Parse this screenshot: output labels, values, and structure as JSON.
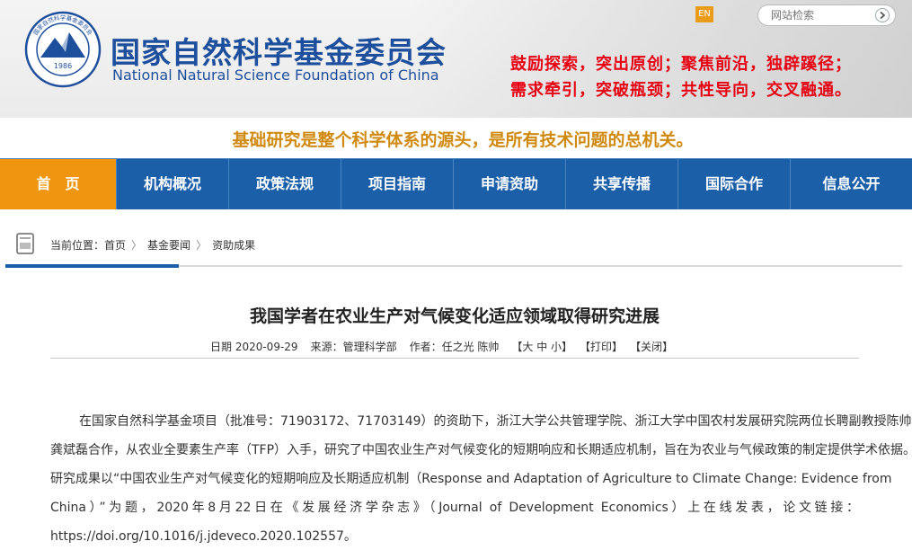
{
  "header": {
    "org_name_cn": "国家自然科学基金委员会",
    "org_name_en": "National Natural Science Foundation of China",
    "seal_year": "1986",
    "seal_ring_text": "国家自然科学基金委员会",
    "lang_button": "EN",
    "search_placeholder": "网站检索",
    "slogan_line1": "鼓励探索，突出原创；聚焦前沿，独辟蹊径；",
    "slogan_line2": "需求牵引，突破瓶颈；共性导向，交叉融通。"
  },
  "tagline": "基础研究是整个科学体系的源头，是所有技术问题的总机关。",
  "nav": {
    "items": [
      "首　页",
      "机构概况",
      "政策法规",
      "项目指南",
      "申请资助",
      "共享传播",
      "国际合作",
      "信息公开"
    ]
  },
  "breadcrumb": {
    "prefix": "当前位置：",
    "items": [
      "首页",
      "基金要闻",
      "资助成果"
    ],
    "separator": "〉"
  },
  "article": {
    "title": "我国学者在农业生产对气候变化适应领域取得研究进展",
    "date": "日期 2020-09-29",
    "source": "来源：管理科学部",
    "author": "作者：任之光 陈帅",
    "font_size_control": "【大 中 小】",
    "print": "【打印】",
    "close": "【关闭】",
    "lines": [
      "在国家自然科学基金项目（批准号：71903172、71703149）的资助下，浙江大学公共管理学院、浙江大学中国农村发展研究院两位长聘副教授陈帅和",
      "龚斌磊合作，从农业全要素生产率（TFP）入手，研究了中国农业生产对气候变化的短期响应和长期适应机制，旨在为农业与气候政策的制定提供学术依据。",
      "研究成果以“中国农业生产对气候变化的短期响应及长期适应机制（Response and Adaptation of Agriculture to Climate Change: Evidence from",
      "China）”为题，2020年8月22日在《发展经济学杂志》（Journal of Development Economics）上在线发表，论文链接：",
      "https://doi.org/10.1016/j.jdeveco.2020.102557。"
    ]
  },
  "colors": {
    "brand_blue": "#1a5fa8",
    "nav_active": "#f0960e",
    "slogan_red": "#e60012",
    "tagline_gold": "#d08a10"
  }
}
